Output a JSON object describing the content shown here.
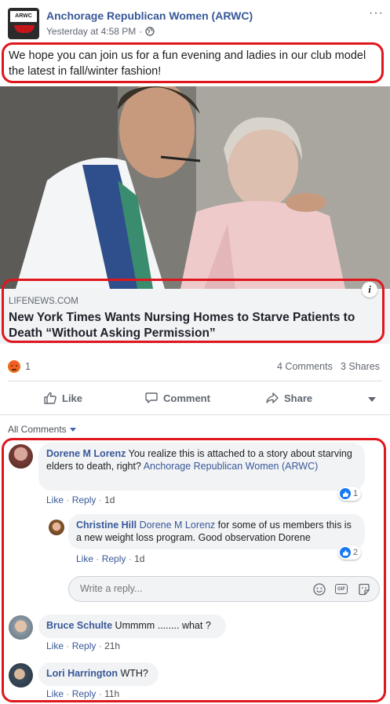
{
  "post": {
    "page_name": "Anchorage Republican Women (ARWC)",
    "avatar_text": "ARWC",
    "timestamp": "Yesterday at 4:58 PM",
    "timestamp_sep": "·",
    "more": "···",
    "text": "We hope you can join us for a fun evening and ladies in our club model the latest in fall/winter fashion!"
  },
  "link_preview": {
    "domain": "LIFENEWS.COM",
    "title": "New York Times Wants Nursing Homes to Starve Patients to Death “Without Asking Permission”",
    "info": "i"
  },
  "reactions": {
    "count": "1",
    "comments": "4 Comments",
    "shares": "3 Shares",
    "angry_color": "#e9710f"
  },
  "actions": {
    "like": "Like",
    "comment": "Comment",
    "share": "Share"
  },
  "filter": {
    "label": "All Comments"
  },
  "comments": [
    {
      "author": "Dorene M Lorenz",
      "text": "You realize this is attached to a story about starving elders to death, right?",
      "mention": "Anchorage Republican Women (ARWC)",
      "like": "Like",
      "reply": "Reply",
      "time": "1d",
      "likes": "1"
    },
    {
      "author": "Christine Hill",
      "mention": "Dorene M Lorenz",
      "text": "for some of us members this is a new weight loss program. Good observation Dorene",
      "like": "Like",
      "reply": "Reply",
      "time": "1d",
      "likes": "2"
    },
    {
      "author": "Bruce Schulte",
      "text": "Ummmm ........ what ?",
      "like": "Like",
      "reply": "Reply",
      "time": "21h"
    },
    {
      "author": "Lori Harrington",
      "text": "WTH?",
      "like": "Like",
      "reply": "Reply",
      "time": "11h"
    }
  ],
  "reply_box": {
    "placeholder": "Write a reply..."
  },
  "colors": {
    "accent": "#385898",
    "highlight_border": "#e0161d",
    "like_blue": "#1877f2"
  }
}
